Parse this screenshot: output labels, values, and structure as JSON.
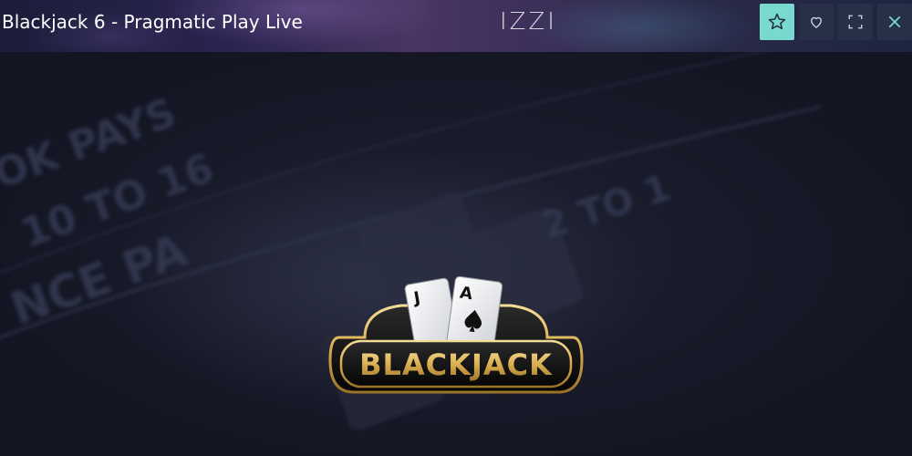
{
  "header": {
    "title": "Blackjack 6 - Pragmatic Play Live",
    "brand": "IZZI",
    "controls": [
      {
        "name": "favorite-star",
        "icon": "star-icon",
        "active": true
      },
      {
        "name": "like-heart",
        "icon": "heart-icon",
        "active": false
      },
      {
        "name": "fullscreen",
        "icon": "fullscreen-icon",
        "active": false
      },
      {
        "name": "close",
        "icon": "close-icon",
        "active": false
      }
    ]
  },
  "game": {
    "logo_text": "BLACKJACK",
    "card_left": "J",
    "card_right": "A"
  },
  "colors": {
    "accent": "#7ad9cf",
    "logo_gold": "#e8c46a",
    "background": "#141623"
  }
}
